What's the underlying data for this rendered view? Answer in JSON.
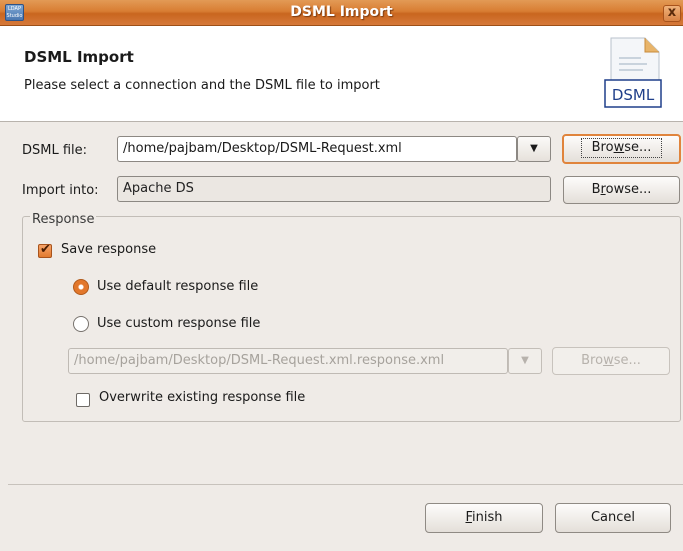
{
  "window": {
    "title": "DSML Import",
    "close_glyph": "x",
    "app_icon_text": "LDAP Studio"
  },
  "header": {
    "title": "DSML Import",
    "description": "Please select a connection and the DSML file to import",
    "logo_text": "DSML"
  },
  "dsml_file": {
    "label": "DSML file:",
    "value": "/home/pajbam/Desktop/DSML-Request.xml",
    "browse_pre": "Bro",
    "browse_mn": "w",
    "browse_post": "se..."
  },
  "import_into": {
    "label": "Import into:",
    "value": "Apache DS",
    "browse_pre": "B",
    "browse_mn": "r",
    "browse_post": "owse..."
  },
  "response": {
    "group_title": "Response",
    "save_response": {
      "label": "Save response",
      "checked": true
    },
    "use_default": {
      "label": "Use default response file",
      "selected": true
    },
    "use_custom": {
      "label": "Use custom response file",
      "selected": false
    },
    "custom_file_value": "/home/pajbam/Desktop/DSML-Request.xml.response.xml",
    "custom_browse_pre": "Bro",
    "custom_browse_mn": "w",
    "custom_browse_post": "se...",
    "overwrite": {
      "label": "Overwrite existing response file",
      "checked": false
    }
  },
  "footer": {
    "finish_mn": "F",
    "finish_post": "inish",
    "cancel_label": "Cancel"
  },
  "colors": {
    "accent": "#e0843c",
    "titlebar": "#d87d33",
    "background": "#efebe7"
  }
}
